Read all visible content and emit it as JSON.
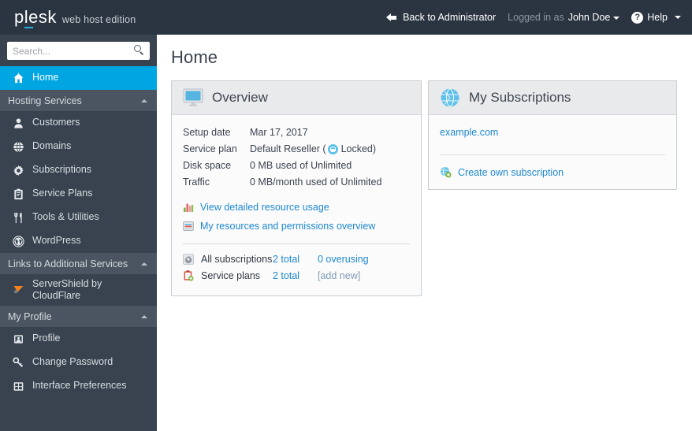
{
  "header": {
    "logo_text": "plesk",
    "logo_edition": "web host edition",
    "back_to_admin": "Back to Administrator",
    "logged_in_as": "Logged in as",
    "username": "John Doe",
    "help": "Help"
  },
  "sidebar": {
    "search_placeholder": "Search...",
    "search_value": "",
    "home": {
      "label": "Home",
      "icon": "home-icon"
    },
    "groups": [
      {
        "label": "Hosting Services",
        "items": [
          {
            "label": "Customers",
            "icon": "user-icon"
          },
          {
            "label": "Domains",
            "icon": "globe-icon"
          },
          {
            "label": "Subscriptions",
            "icon": "gear-icon"
          },
          {
            "label": "Service Plans",
            "icon": "clipboard-icon"
          },
          {
            "label": "Tools & Utilities",
            "icon": "fork-knife-icon"
          },
          {
            "label": "WordPress",
            "icon": "wordpress-icon"
          }
        ]
      },
      {
        "label": "Links to Additional Services",
        "items": [
          {
            "label": "ServerShield by CloudFlare",
            "icon": "cloudflare-icon"
          }
        ]
      },
      {
        "label": "My Profile",
        "items": [
          {
            "label": "Profile",
            "icon": "profile-card-icon"
          },
          {
            "label": "Change Password",
            "icon": "key-icon"
          },
          {
            "label": "Interface Preferences",
            "icon": "grid-icon"
          }
        ]
      }
    ]
  },
  "main": {
    "page_title": "Home",
    "overview": {
      "title": "Overview",
      "icon": "monitor-icon",
      "rows": [
        {
          "key": "Setup date",
          "value": "Mar 17, 2017"
        },
        {
          "key": "Service plan",
          "value_before": "Default Reseller (",
          "badge": "lock-icon",
          "value_after": "Locked)"
        },
        {
          "key": "Disk space",
          "value": "0 MB used of Unlimited"
        },
        {
          "key": "Traffic",
          "value": "0 MB/month used of Unlimited"
        }
      ],
      "links": [
        {
          "label": "View detailed resource usage",
          "icon": "bar-chart-icon"
        },
        {
          "label": "My resources and permissions overview",
          "icon": "report-icon"
        }
      ],
      "stats": [
        {
          "icon": "subscriptions-icon",
          "name": "All subscriptions",
          "total": "2 total",
          "extra": "0 overusing"
        },
        {
          "icon": "service-plan-icon",
          "name": "Service plans",
          "total": "2 total",
          "extra": "[add new]"
        }
      ]
    },
    "subscriptions": {
      "title": "My Subscriptions",
      "icon": "globe-blue-icon",
      "items": [
        {
          "label": "example.com"
        }
      ],
      "create_label": "Create own subscription",
      "create_icon": "add-globe-icon"
    }
  },
  "colors": {
    "topbar_bg": "#2b3541",
    "sidebar_bg": "#38434f",
    "active_item": "#00a6e2",
    "group_header_bg": "#4b5561",
    "link_blue": "#1e88d0",
    "panel_head_bg": "#e9eaec",
    "panel_border": "#c8cdd2",
    "accent_cyan": "#28b0e6"
  }
}
